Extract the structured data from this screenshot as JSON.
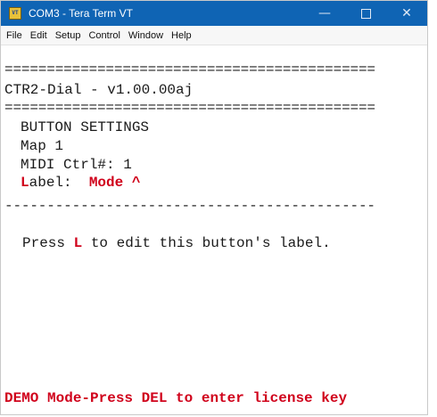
{
  "window": {
    "title": "COM3 - Tera Term VT",
    "app_icon_text": "VT",
    "minimize_glyph": "—",
    "close_glyph": "✕"
  },
  "menu": [
    "File",
    "Edit",
    "Setup",
    "Control",
    "Window",
    "Help"
  ],
  "terminal": {
    "separator_double": "============================================",
    "header": "CTR2-Dial - v1.00.00aj",
    "section_title": "BUTTON SETTINGS",
    "map": "Map 1",
    "midi_ctrl": "MIDI Ctrl#: 1",
    "label_hotkey": "L",
    "label_rest": "abel:",
    "label_value": "Mode ^",
    "separator_single": "--------------------------------------------",
    "hint_prefix": "Press ",
    "hint_key": "L",
    "hint_suffix": " to edit this button's label.",
    "demo_notice": "DEMO Mode-Press DEL to enter license key"
  },
  "colors": {
    "titlebar": "#0f64b4",
    "accent_red": "#d0021b"
  }
}
